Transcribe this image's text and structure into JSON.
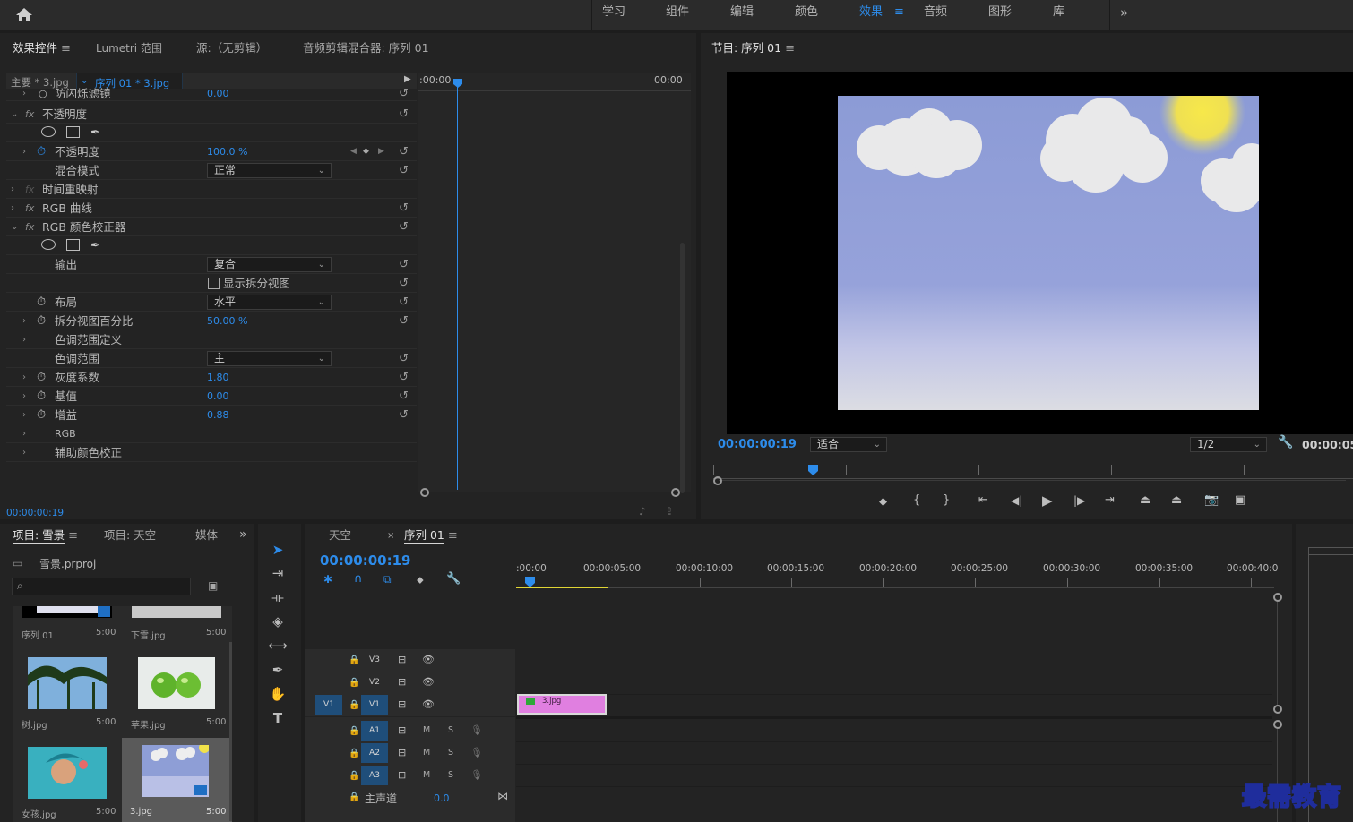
{
  "colors": {
    "accent": "#2d8ceb",
    "panel": "#232323",
    "clip": "#e07fe0"
  },
  "workspaces": [
    {
      "label": "学习",
      "active": false
    },
    {
      "label": "组件",
      "active": false
    },
    {
      "label": "编辑",
      "active": false
    },
    {
      "label": "颜色",
      "active": false
    },
    {
      "label": "效果",
      "active": true
    },
    {
      "label": "音频",
      "active": false
    },
    {
      "label": "图形",
      "active": false
    },
    {
      "label": "库",
      "active": false
    }
  ],
  "effects_panel": {
    "tabs": [
      "效果控件",
      "Lumetri 范围",
      "源:（无剪辑）",
      "音频剪辑混合器: 序列 01"
    ],
    "clip_master": "主要 * 3.jpg",
    "clip_seq": "序列 01 * 3.jpg",
    "ruler_start": ":00:00",
    "ruler_end": "00:00",
    "timecode": "00:00:00:19",
    "rows": {
      "flicker": "防闪烁滤镜",
      "flicker_val": "0.00",
      "opacity_group": "不透明度",
      "opacity": "不透明度",
      "opacity_val": "100.0 %",
      "blend": "混合模式",
      "blend_val": "正常",
      "time_remap": "时间重映射",
      "rgb_curves": "RGB 曲线",
      "rgb_corrector": "RGB 颜色校正器",
      "output": "输出",
      "output_val": "复合",
      "split_view": "显示拆分视图",
      "layout": "布局",
      "layout_val": "水平",
      "split_pct": "拆分视图百分比",
      "split_pct_val": "50.00 %",
      "tonal_def": "色调范围定义",
      "tonal": "色调范围",
      "tonal_val": "主",
      "gamma": "灰度系数",
      "gamma_val": "1.80",
      "pedestal": "基值",
      "pedestal_val": "0.00",
      "gain": "增益",
      "gain_val": "0.88",
      "rgb": "RGB",
      "aux": "辅助颜色校正"
    }
  },
  "program_monitor": {
    "title": "节目: 序列 01",
    "timecode": "00:00:00:19",
    "fit": "适合",
    "resolution": "1/2",
    "duration": "00:00:05"
  },
  "project_panel": {
    "tabs": [
      "项目: 雪景",
      "项目: 天空",
      "媒体"
    ],
    "file": "雪景.prproj",
    "search_placeholder": "",
    "items": [
      {
        "name": "序列 01",
        "dur": "5:00"
      },
      {
        "name": "下雪.jpg",
        "dur": "5:00"
      },
      {
        "name": "树.jpg",
        "dur": "5:00"
      },
      {
        "name": "苹果.jpg",
        "dur": "5:00"
      },
      {
        "name": "女孩.jpg",
        "dur": "5:00"
      },
      {
        "name": "3.jpg",
        "dur": "5:00"
      }
    ]
  },
  "timeline": {
    "tabs": [
      "天空",
      "序列 01"
    ],
    "timecode": "00:00:00:19",
    "ruler": [
      ":00:00",
      "00:00:05:00",
      "00:00:10:00",
      "00:00:15:00",
      "00:00:20:00",
      "00:00:25:00",
      "00:00:30:00",
      "00:00:35:00",
      "00:00:40:0"
    ],
    "video_tracks": [
      "V3",
      "V2",
      "V1"
    ],
    "audio_tracks": [
      "A1",
      "A2",
      "A3"
    ],
    "source_v": "V1",
    "m": "M",
    "s": "S",
    "master": "主声道",
    "master_val": "0.0",
    "clip": "3.jpg"
  },
  "watermark": "最需教育"
}
